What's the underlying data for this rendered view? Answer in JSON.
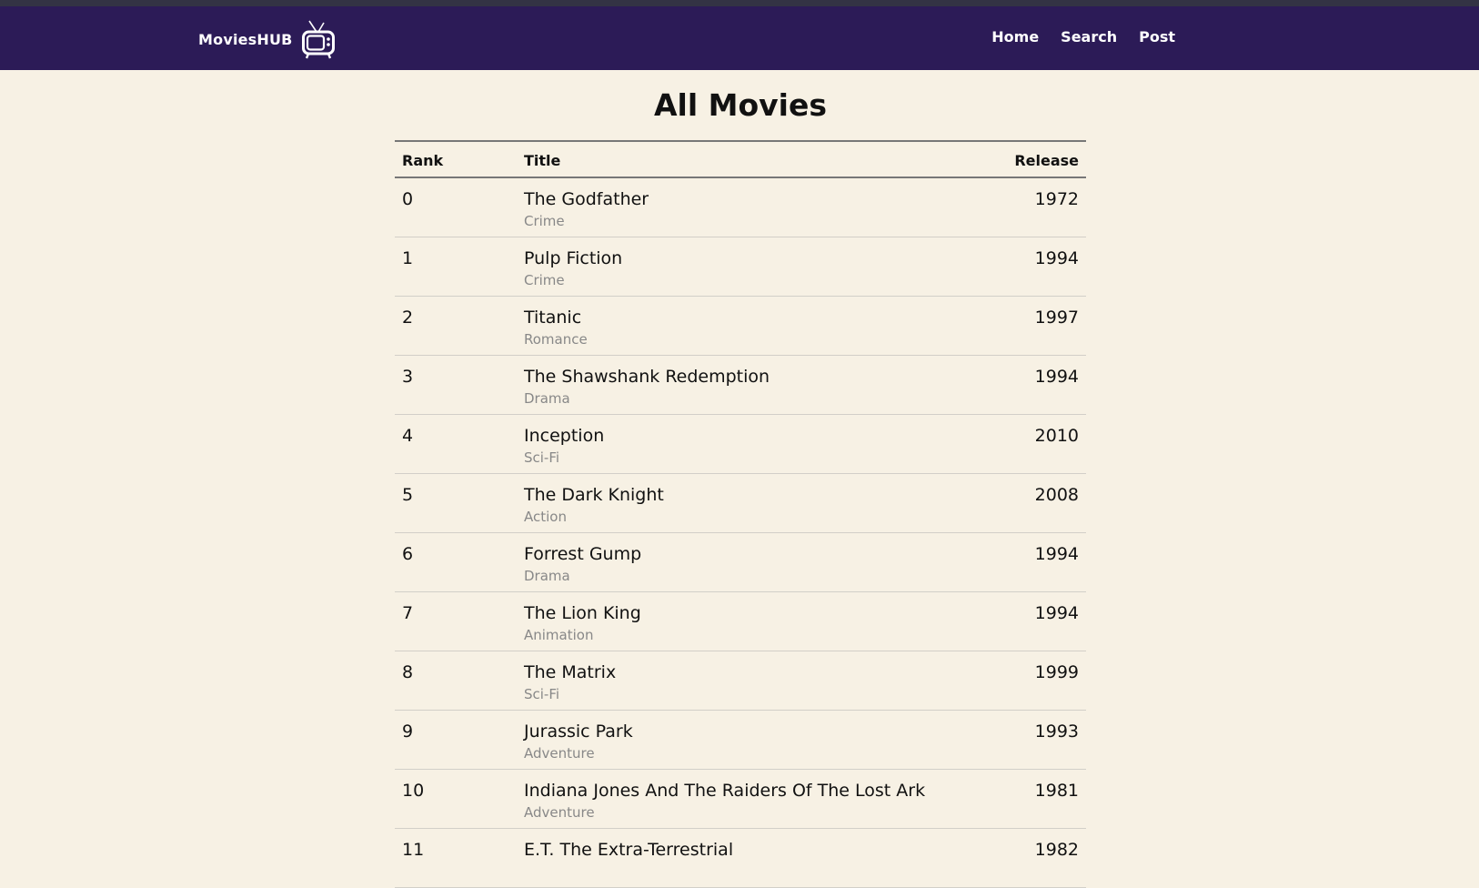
{
  "brand": {
    "name": "MoviesHUB",
    "icon": "tv-icon"
  },
  "nav": {
    "links": [
      "Home",
      "Search",
      "Post"
    ]
  },
  "page": {
    "title": "All Movies"
  },
  "table": {
    "headers": {
      "rank": "Rank",
      "title": "Title",
      "release": "Release"
    },
    "rows": [
      {
        "rank": "0",
        "title": "The Godfather",
        "genre": "Crime",
        "release": "1972"
      },
      {
        "rank": "1",
        "title": "Pulp Fiction",
        "genre": "Crime",
        "release": "1994"
      },
      {
        "rank": "2",
        "title": "Titanic",
        "genre": "Romance",
        "release": "1997"
      },
      {
        "rank": "3",
        "title": "The Shawshank Redemption",
        "genre": "Drama",
        "release": "1994"
      },
      {
        "rank": "4",
        "title": "Inception",
        "genre": "Sci-Fi",
        "release": "2010"
      },
      {
        "rank": "5",
        "title": "The Dark Knight",
        "genre": "Action",
        "release": "2008"
      },
      {
        "rank": "6",
        "title": "Forrest Gump",
        "genre": "Drama",
        "release": "1994"
      },
      {
        "rank": "7",
        "title": "The Lion King",
        "genre": "Animation",
        "release": "1994"
      },
      {
        "rank": "8",
        "title": "The Matrix",
        "genre": "Sci-Fi",
        "release": "1999"
      },
      {
        "rank": "9",
        "title": "Jurassic Park",
        "genre": "Adventure",
        "release": "1993"
      },
      {
        "rank": "10",
        "title": "Indiana Jones And The Raiders Of The Lost Ark",
        "genre": "Adventure",
        "release": "1981"
      },
      {
        "rank": "11",
        "title": "E.T. The Extra-Terrestrial",
        "genre": "",
        "release": "1982"
      }
    ]
  },
  "colors": {
    "navbar": "#2c1b57",
    "background": "#f7f1e4",
    "genre_text": "#888888"
  }
}
